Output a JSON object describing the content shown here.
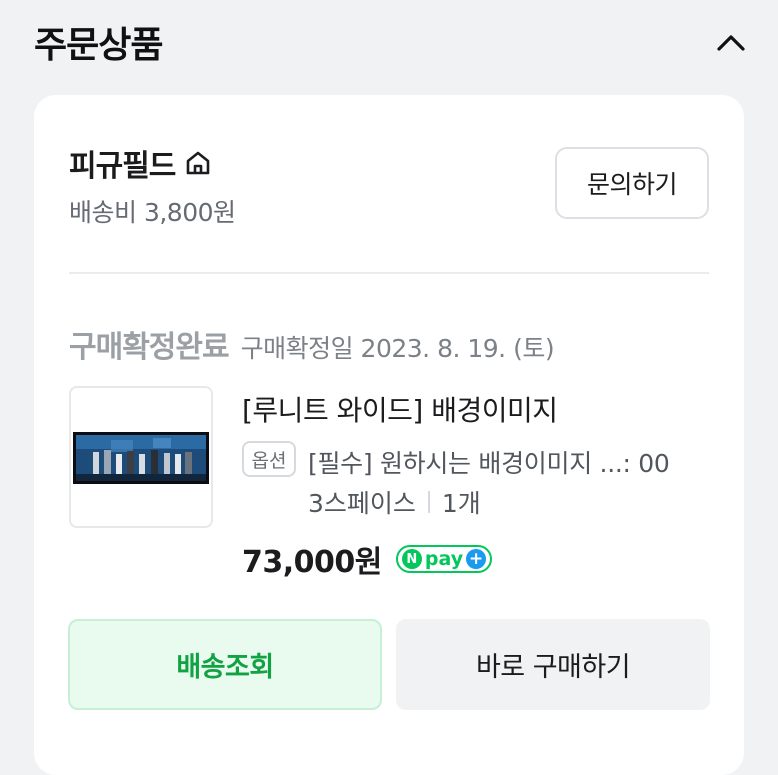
{
  "section": {
    "title": "주문상품",
    "collapse_icon": "chevron-up-icon"
  },
  "seller": {
    "name": "피규필드",
    "home_icon": "home-icon",
    "shipping_fee": "배송비 3,800원",
    "inquiry_label": "문의하기"
  },
  "order": {
    "status": "구매확정완료",
    "confirm_date": "구매확정일 2023. 8. 19. (토)"
  },
  "product": {
    "title": "[루니트 와이드] 배경이미지",
    "option_badge": "옵션",
    "option_text": "[필수] 원하시는 배경이미지 ...: 00",
    "option_variant": "3스페이스",
    "quantity": "1개",
    "price": "73,000원",
    "pay_badge": "pay"
  },
  "actions": {
    "track_label": "배송조회",
    "buy_again_label": "바로 구매하기"
  },
  "colors": {
    "accent_green": "#11a243",
    "npay_green": "#03c75a",
    "npay_plus_blue": "#1a9bf0"
  }
}
